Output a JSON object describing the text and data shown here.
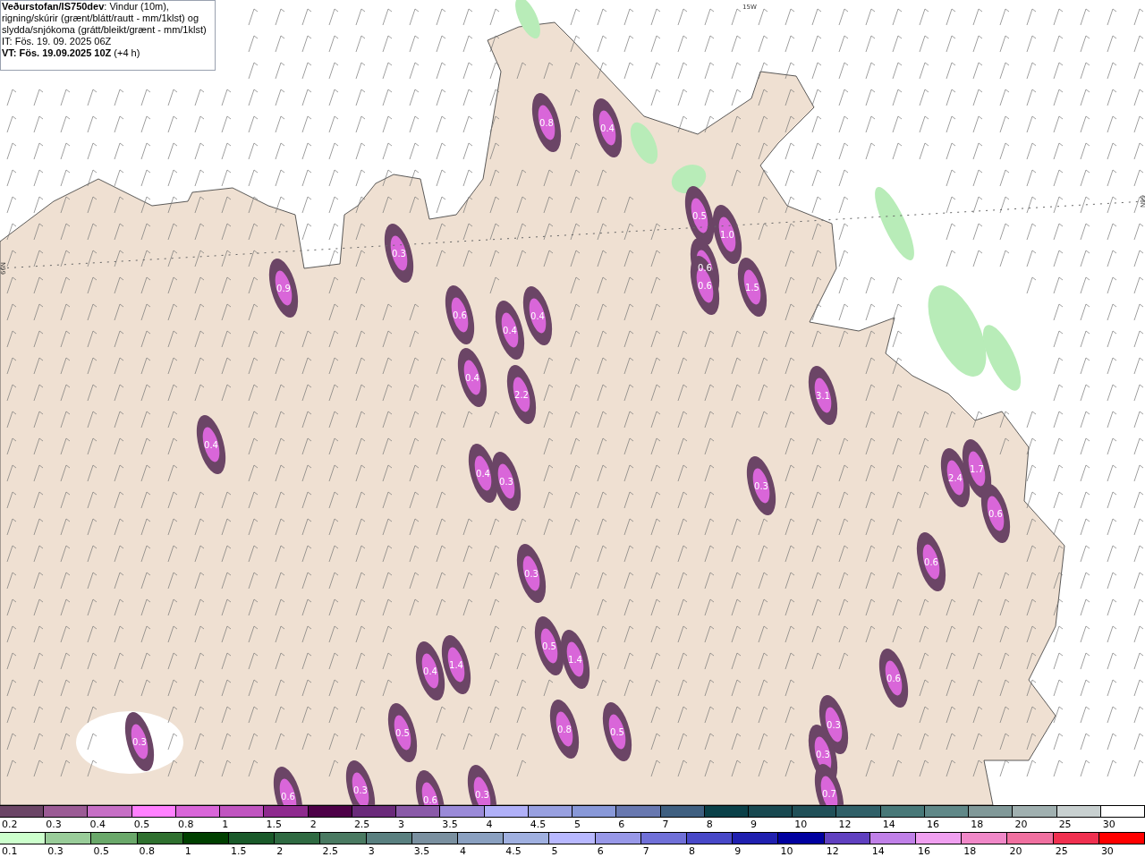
{
  "header": {
    "description": "**Veðurstofan/IS750dev**: Vindur (10m), rigning/skúrir (grænt/blátt/rautt - mm/1klst) og slydda/snjókoma (grátt/bleikt/grænt - mm/1klst)",
    "issue_time": "IT: Fös. 19. 09. 2025 06Z",
    "valid_time": "**VT: Fös. 19.09.2025 10Z** (+4 h)"
  },
  "map": {
    "grid_labels": [
      {
        "kind": "top",
        "text": "15W"
      },
      {
        "kind": "right",
        "text": "66N"
      },
      {
        "kind": "left",
        "text": "66N"
      }
    ],
    "labels": [
      "0.8",
      "0.4",
      "0.5",
      "1.0",
      "0.6",
      "0.6",
      "1.5",
      "0.3",
      "0.9",
      "0.6",
      "0.4",
      "0.4",
      "0.4",
      "2.2",
      "3.1",
      "0.4",
      "0.4",
      "0.3",
      "2.4",
      "1.7",
      "0.3",
      "0.6",
      "0.3",
      "0.6",
      "0.5",
      "1.4",
      "0.4",
      "1.4",
      "0.6",
      "0.3",
      "0.3",
      "0.5",
      "0.8",
      "0.5",
      "0.3",
      "0.6",
      "0.3",
      "0.6",
      "0.3",
      "0.7"
    ]
  },
  "legends": [
    {
      "kind": "snow",
      "items": [
        {
          "label": "0.2",
          "color": "#6b4566"
        },
        {
          "label": "0.3",
          "color": "#9b5b95"
        },
        {
          "label": "0.4",
          "color": "#c66fc5"
        },
        {
          "label": "0.5",
          "color": "#ff80ff"
        },
        {
          "label": "0.8",
          "color": "#d966d9"
        },
        {
          "label": "1",
          "color": "#c055c0"
        },
        {
          "label": "1.5",
          "color": "#8e2a8e"
        },
        {
          "label": "2",
          "color": "#4d0047"
        },
        {
          "label": "2.5",
          "color": "#6a2a7a"
        },
        {
          "label": "3",
          "color": "#8a5aa8"
        },
        {
          "label": "3.5",
          "color": "#9a8ad8"
        },
        {
          "label": "4",
          "color": "#b0b0f8"
        },
        {
          "label": "4.5",
          "color": "#98a0e0"
        },
        {
          "label": "5",
          "color": "#8898d8"
        },
        {
          "label": "6",
          "color": "#6878b0"
        },
        {
          "label": "7",
          "color": "#3f5f80"
        },
        {
          "label": "8",
          "color": "#0a4048"
        },
        {
          "label": "9",
          "color": "#184850"
        },
        {
          "label": "10",
          "color": "#205058"
        },
        {
          "label": "12",
          "color": "#306068"
        },
        {
          "label": "14",
          "color": "#487878"
        },
        {
          "label": "16",
          "color": "#608888"
        },
        {
          "label": "18",
          "color": "#809898"
        },
        {
          "label": "20",
          "color": "#a0b0b0"
        },
        {
          "label": "25",
          "color": "#c8d0d0"
        },
        {
          "label": "30",
          "color": "#ffffff"
        }
      ]
    },
    {
      "kind": "rain",
      "items": [
        {
          "label": "0.1",
          "color": "#ccffcc"
        },
        {
          "label": "0.3",
          "color": "#99cc99"
        },
        {
          "label": "0.5",
          "color": "#6aa86a"
        },
        {
          "label": "0.8",
          "color": "#2f702f"
        },
        {
          "label": "1",
          "color": "#004000"
        },
        {
          "label": "1.5",
          "color": "#1a5a2a"
        },
        {
          "label": "2",
          "color": "#2f6a42"
        },
        {
          "label": "2.5",
          "color": "#4a7a62"
        },
        {
          "label": "3",
          "color": "#5a8080"
        },
        {
          "label": "3.5",
          "color": "#7a90a0"
        },
        {
          "label": "4",
          "color": "#8aa0c0"
        },
        {
          "label": "4.5",
          "color": "#a0b0e0"
        },
        {
          "label": "5",
          "color": "#b8b8ff"
        },
        {
          "label": "6",
          "color": "#9898e8"
        },
        {
          "label": "7",
          "color": "#7070d8"
        },
        {
          "label": "8",
          "color": "#4848c8"
        },
        {
          "label": "9",
          "color": "#2020b0"
        },
        {
          "label": "10",
          "color": "#0000a0"
        },
        {
          "label": "12",
          "color": "#6040c0"
        },
        {
          "label": "14",
          "color": "#c080e8"
        },
        {
          "label": "16",
          "color": "#f0a0f0"
        },
        {
          "label": "18",
          "color": "#f088c8"
        },
        {
          "label": "20",
          "color": "#f070a0"
        },
        {
          "label": "25",
          "color": "#f03050"
        },
        {
          "label": "30",
          "color": "#ff0000"
        }
      ]
    }
  ]
}
